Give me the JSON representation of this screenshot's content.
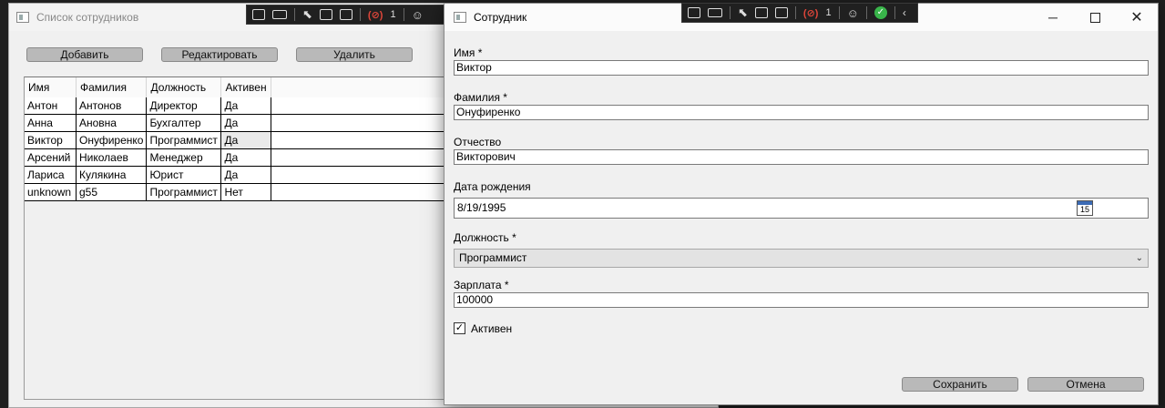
{
  "bg_window": {
    "title": "Список сотрудников",
    "buttons": {
      "add": "Добавить",
      "edit": "Редактировать",
      "delete": "Удалить"
    },
    "columns": [
      "Имя",
      "Фамилия",
      "Должность",
      "Активен"
    ],
    "rows": [
      [
        "Антон",
        "Антонов",
        "Директор",
        "Да"
      ],
      [
        "Анна",
        "Ановна",
        "Бухгалтер",
        "Да"
      ],
      [
        "Виктор",
        "Онуфиренко",
        "Программист",
        "Да"
      ],
      [
        "Арсений",
        "Николаев",
        "Менеджер",
        "Да"
      ],
      [
        "Лариса",
        "Кулякина",
        "Юрист",
        "Да"
      ],
      [
        "unknown",
        "g55",
        "Программист",
        "Нет"
      ]
    ]
  },
  "devtools": {
    "badge_count_bg": "1",
    "badge_count_dlg": "1"
  },
  "dialog": {
    "title": "Сотрудник",
    "first_name_label": "Имя *",
    "first_name": "Виктор",
    "last_name_label": "Фамилия *",
    "last_name": "Онуфиренко",
    "patronymic_label": "Отчество",
    "patronymic": "Викторович",
    "birth_label": "Дата рождения",
    "birth_date": "8/19/1995",
    "calendar_day": "15",
    "position_label": "Должность *",
    "position": "Программист",
    "salary_label": "Зарплата *",
    "salary": "100000",
    "active_label": "Активен",
    "active_checked": true,
    "save": "Сохранить",
    "cancel": "Отмена"
  }
}
